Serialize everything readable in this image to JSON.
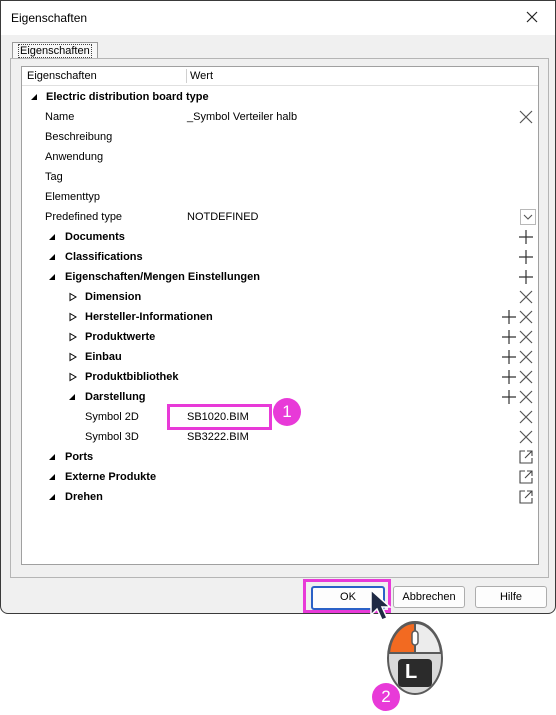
{
  "window": {
    "title": "Eigenschaften"
  },
  "tab": {
    "label": "Eigenschaften"
  },
  "grid": {
    "col_property": "Eigenschaften",
    "col_value": "Wert",
    "group_title": "Electric distribution board type",
    "rows": {
      "name": {
        "label": "Name",
        "value": "_Symbol Verteiler halb"
      },
      "beschreibung": {
        "label": "Beschreibung"
      },
      "anwendung": {
        "label": "Anwendung"
      },
      "tag": {
        "label": "Tag"
      },
      "elementtyp": {
        "label": "Elementtyp"
      },
      "predefined": {
        "label": "Predefined type",
        "value": "NOTDEFINED"
      },
      "documents": {
        "label": "Documents"
      },
      "classifications": {
        "label": "Classifications"
      },
      "eig_mengen": {
        "label": "Eigenschaften/Mengen Einstellungen"
      },
      "dimension": {
        "label": "Dimension"
      },
      "hersteller": {
        "label": "Hersteller-Informationen"
      },
      "produktwerte": {
        "label": "Produktwerte"
      },
      "einbau": {
        "label": "Einbau"
      },
      "produktbibliothek": {
        "label": "Produktbibliothek"
      },
      "darstellung": {
        "label": "Darstellung"
      },
      "symbol2d": {
        "label": "Symbol 2D",
        "value": "SB1020.BIM"
      },
      "symbol3d": {
        "label": "Symbol 3D",
        "value": "SB3222.BIM"
      },
      "ports": {
        "label": "Ports"
      },
      "externe": {
        "label": "Externe Produkte"
      },
      "drehen": {
        "label": "Drehen"
      }
    }
  },
  "buttons": {
    "ok": "OK",
    "cancel": "Abbrechen",
    "help": "Hilfe"
  },
  "callouts": {
    "step1": "1",
    "step2": "2",
    "mouse_button": "L"
  },
  "colors": {
    "highlight": "#e83ad8",
    "mouse_accent": "#f26a21",
    "default_button_border": "#2a61c7"
  }
}
